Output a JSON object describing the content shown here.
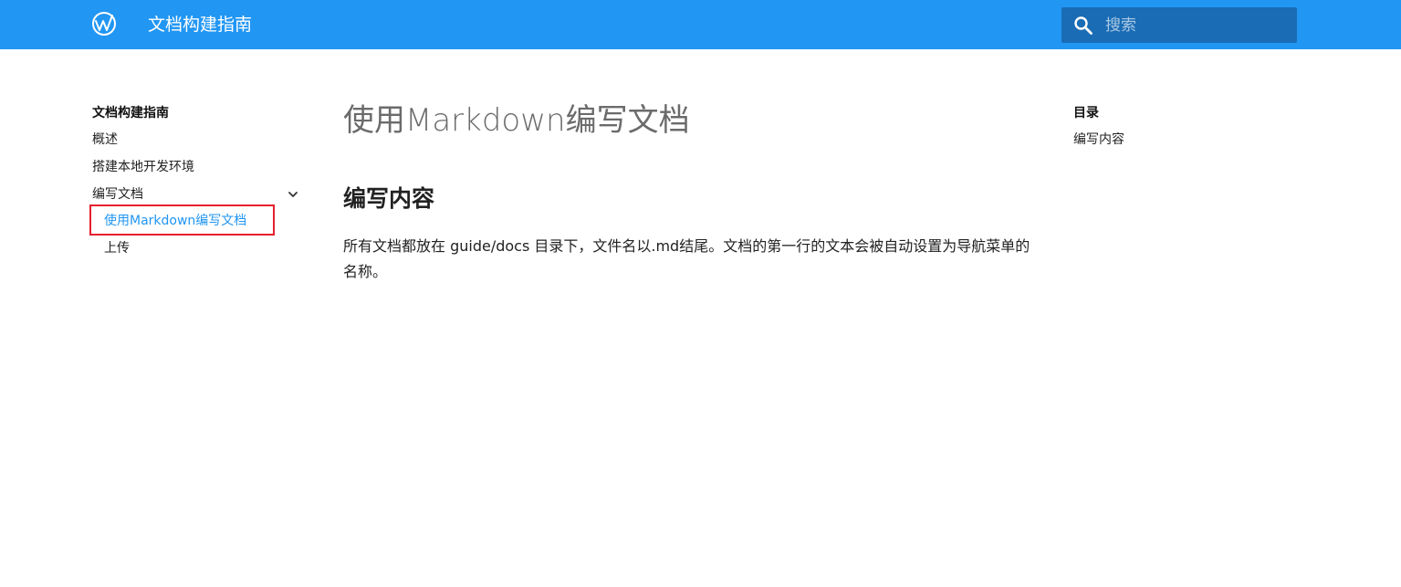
{
  "header": {
    "site_title": "文档构建指南",
    "logo_icon": "logo-icon",
    "search": {
      "placeholder": "搜索",
      "value": "",
      "icon": "search-icon"
    },
    "colors": {
      "header_bg": "#2196f3",
      "search_bg": "#1a6cb5"
    }
  },
  "nav": {
    "title": "文档构建指南",
    "items": [
      {
        "label": "概述"
      },
      {
        "label": "搭建本地开发环境"
      },
      {
        "label": "编写文档",
        "expanded": true,
        "icon": "chevron-down-icon",
        "children": [
          {
            "label": "使用Markdown编写文档",
            "active": true
          },
          {
            "label": "上传"
          }
        ]
      }
    ],
    "colors": {
      "active": "#2196f3",
      "highlight": "#e5202e"
    }
  },
  "content": {
    "page_title": "使用Markdown编写文档",
    "section_title": "编写内容",
    "paragraph": "所有文档都放在 guide/docs 目录下，文件名以.md结尾。文档的第一行的文本会被自动设置为导航菜单的名称。"
  },
  "toc": {
    "title": "目录",
    "items": [
      {
        "label": "编写内容"
      }
    ]
  }
}
